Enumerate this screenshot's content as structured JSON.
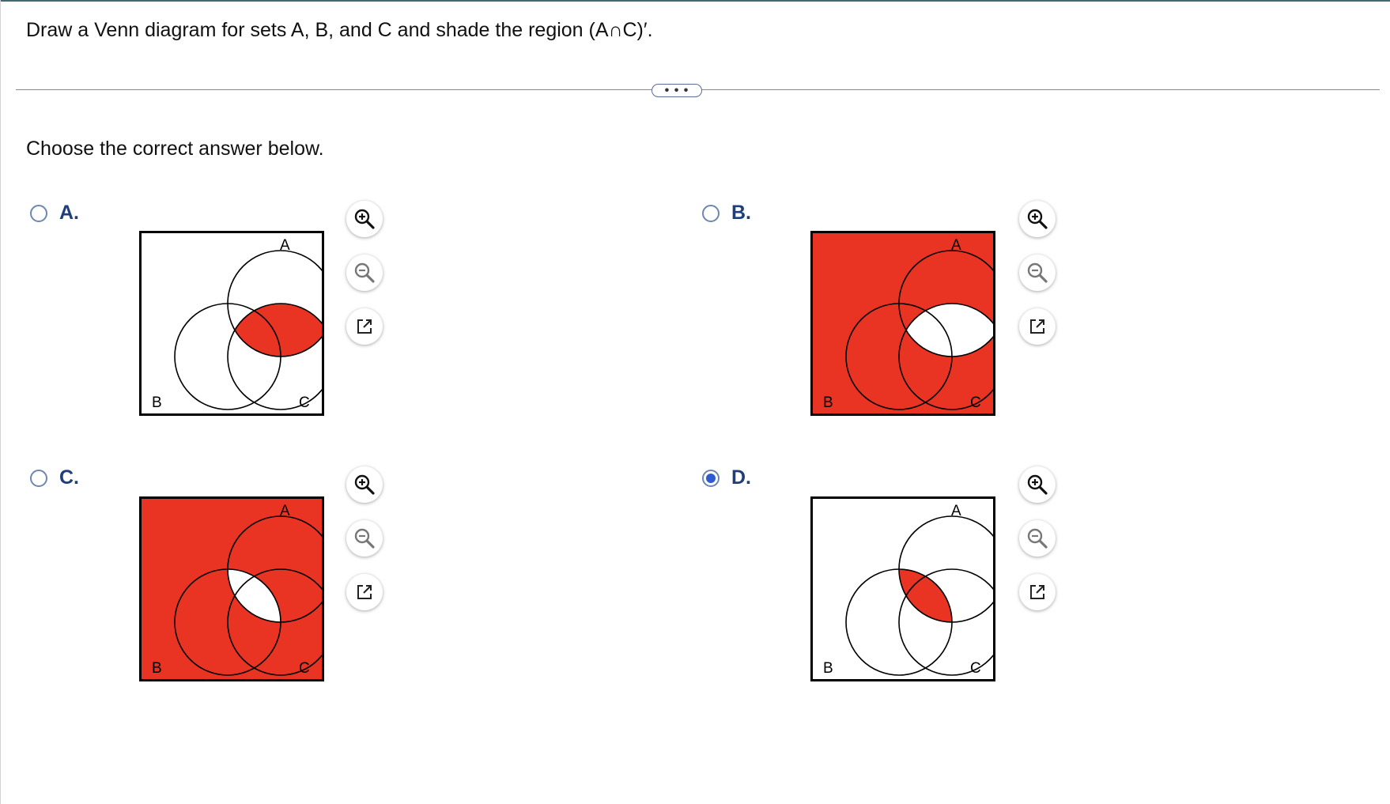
{
  "question": {
    "text": "Draw a Venn diagram for sets A, B, and C and shade the region (A∩C)′."
  },
  "more_button": {
    "label": "• • •"
  },
  "prompt": {
    "text": "Choose the correct answer below."
  },
  "colors": {
    "shade": "#e93323",
    "radio_selected": "#2f5bd0",
    "letter": "#1f3f7a"
  },
  "venn_labels": {
    "a": "A",
    "b": "B",
    "c": "C"
  },
  "choices": [
    {
      "letter": "A.",
      "selected": false,
      "shaded": "A∩C"
    },
    {
      "letter": "B.",
      "selected": false,
      "shaded": "everything except A∩C"
    },
    {
      "letter": "C.",
      "selected": false,
      "shaded": "everything except A∩B"
    },
    {
      "letter": "D.",
      "selected": true,
      "shaded": "A∩B"
    }
  ],
  "tools": [
    "zoom-in-icon",
    "zoom-out-icon",
    "open-external-icon"
  ]
}
